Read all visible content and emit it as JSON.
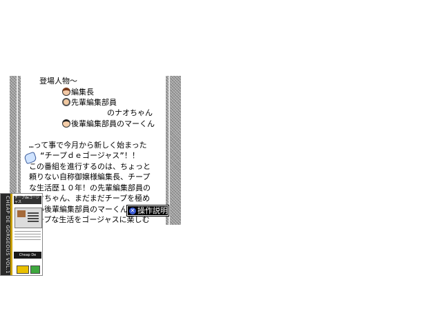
{
  "document": {
    "lines": [
      "登場人物〜",
      "編集長",
      "先輩編集部員",
      "のナオちゃん",
      "後輩編集部員のマーくん",
      "…って事で今月から新しく始まった",
      "“チープｄｅゴージャス”！！",
      "この番組を進行するのは、ちょっと",
      "頼りない自称御嬢様編集長、チープ",
      "な生活歴１０年！の先輩編集部員の",
      "ナオちゃん、まだまだチープを極め",
      "ない後輩編集部員のマーくん",
      "チープな生活をゴージャスに楽しむ"
    ]
  },
  "operation_button": {
    "icon": "x-button-icon",
    "icon_glyph": "✕",
    "label": "操作説明"
  },
  "game_box": {
    "spine_text": "CHEAP DE GORGEOUS VOL.1",
    "logo_text": "チープdeゴージャス",
    "banner_text": "Cheap De Gorgeous"
  },
  "colors": {
    "stripe": "#9c9c9c",
    "button_bg": "#000000",
    "button_icon": "#3b5bd6"
  }
}
